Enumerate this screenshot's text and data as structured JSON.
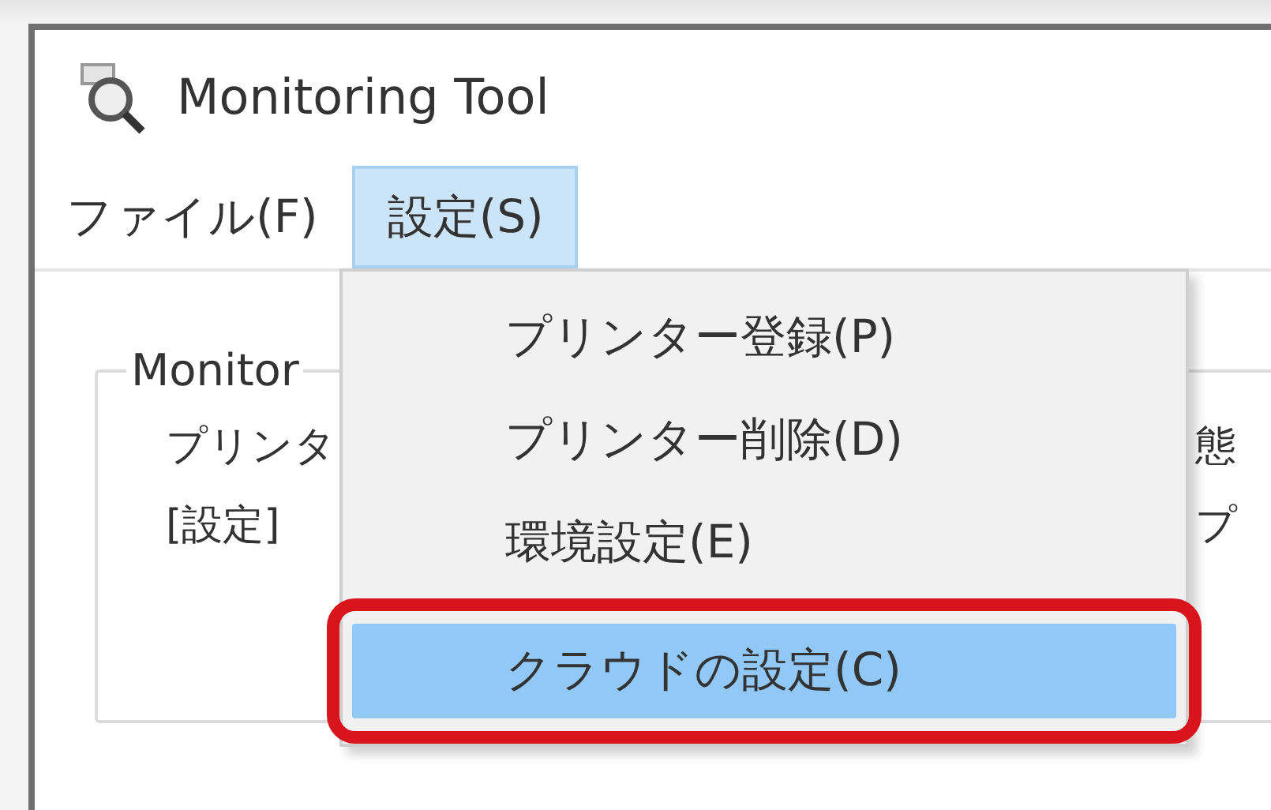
{
  "window": {
    "title": "Monitoring Tool"
  },
  "menu_bar": [
    {
      "label": "ファイル(F)",
      "selected": false
    },
    {
      "label": "設定(S)",
      "selected": true
    }
  ],
  "group_box": {
    "title": "Monitor",
    "lines_left": [
      "プリンタ",
      "[設定]"
    ],
    "lines_right": [
      "態",
      "プ"
    ]
  },
  "dropdown": {
    "items": [
      {
        "label": "プリンター登録(P)",
        "selected": false,
        "annotated": false
      },
      {
        "label": "プリンター削除(D)",
        "selected": false,
        "annotated": false
      },
      {
        "label": "環境設定(E)",
        "selected": false,
        "annotated": false
      },
      {
        "label": "クラウドの設定(C)",
        "selected": true,
        "annotated": true
      }
    ]
  }
}
